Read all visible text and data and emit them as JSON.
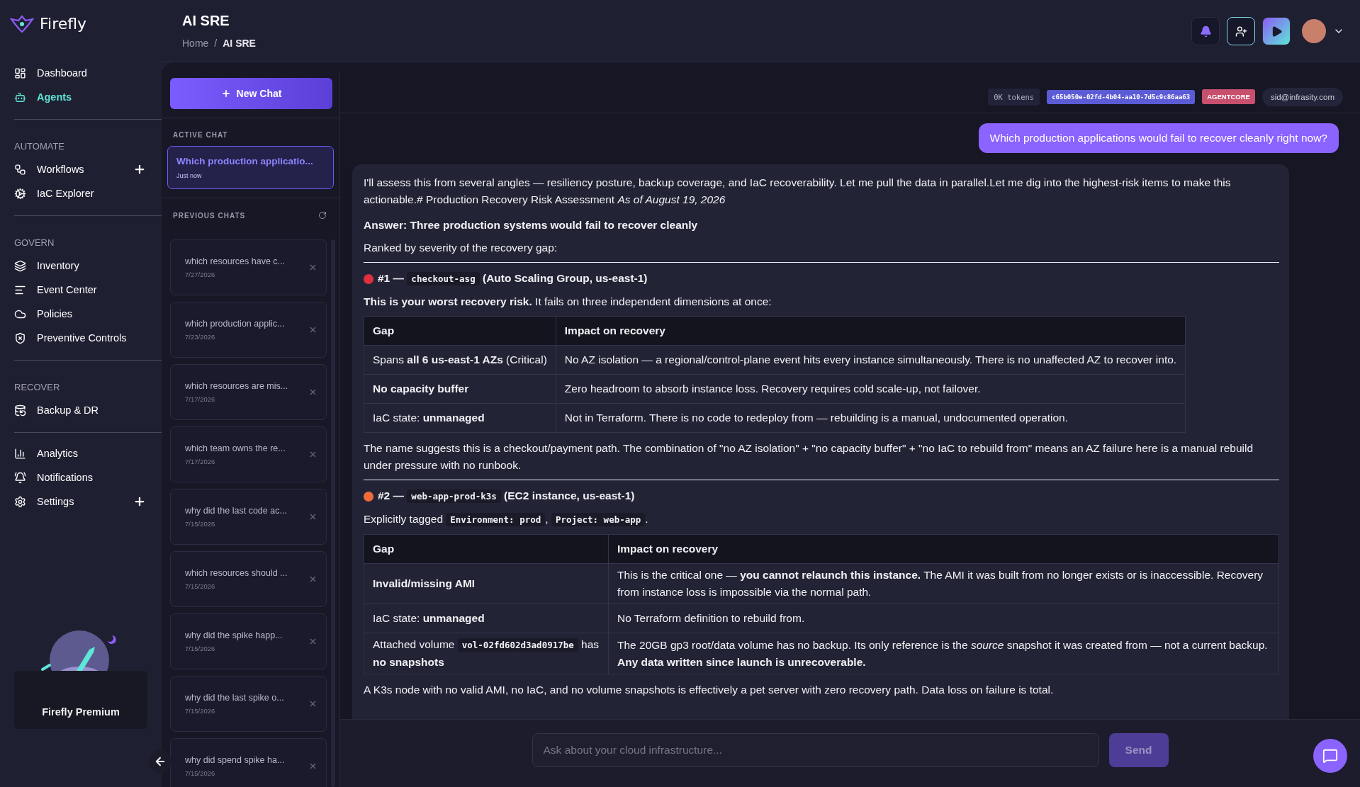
{
  "brand": {
    "name": "Firefly"
  },
  "header": {
    "title": "AI SRE",
    "breadcrumb": [
      "Home",
      "AI SRE"
    ],
    "breadcrumb_separator": "/"
  },
  "nav": [
    {
      "items": [
        {
          "label": "Dashboard",
          "selected": false,
          "has_add": false
        },
        {
          "label": "Agents",
          "selected": true,
          "has_add": false
        }
      ]
    },
    {
      "heading": "AUTOMATE",
      "items": [
        {
          "label": "Workflows",
          "selected": false,
          "has_add": true
        },
        {
          "label": "IaC Explorer",
          "selected": false,
          "has_add": false
        }
      ]
    },
    {
      "heading": "GOVERN",
      "items": [
        {
          "label": "Inventory",
          "selected": false,
          "has_add": false
        },
        {
          "label": "Event Center",
          "selected": false,
          "has_add": false
        },
        {
          "label": "Policies",
          "selected": false,
          "has_add": false
        },
        {
          "label": "Preventive Controls",
          "selected": false,
          "has_add": false
        }
      ]
    },
    {
      "heading": "RECOVER",
      "items": [
        {
          "label": "Backup & DR",
          "selected": false,
          "has_add": false
        }
      ]
    },
    {
      "items": [
        {
          "label": "Analytics",
          "selected": false,
          "has_add": false
        },
        {
          "label": "Notifications",
          "selected": false,
          "has_add": false
        },
        {
          "label": "Settings",
          "selected": false,
          "has_add": true
        }
      ]
    }
  ],
  "premium": {
    "label": "Firefly Premium"
  },
  "chats": {
    "new_chat": "New Chat",
    "active_label": "ACTIVE CHAT",
    "active": {
      "title": "Which production applicatio...",
      "time": "Just now",
      "selected": true
    },
    "previous_label": "PREVIOUS CHATS",
    "previous": [
      {
        "title": "which resources have c...",
        "date": "7/27/2026"
      },
      {
        "title": "which production applic...",
        "date": "7/23/2026"
      },
      {
        "title": "which resources are mis...",
        "date": "7/17/2026"
      },
      {
        "title": "which team owns the re...",
        "date": "7/17/2026"
      },
      {
        "title": "why did the last code ac...",
        "date": "7/15/2026"
      },
      {
        "title": "which resources should ...",
        "date": "7/15/2026"
      },
      {
        "title": "why did the spike happ...",
        "date": "7/15/2026"
      },
      {
        "title": "why did the last spike o...",
        "date": "7/15/2026"
      },
      {
        "title": "why did spend spike ha...",
        "date": "7/15/2026"
      }
    ]
  },
  "session": {
    "tokens": "0K tokens",
    "id": "c65b050e-02fd-4b04-aa10-7d5c9c86aa63",
    "badge": "AGENTCORE",
    "user": "sid@infrasity.com"
  },
  "user_message": "Which production applications would fail to recover cleanly right now?",
  "answer": {
    "intro": "I'll assess this from several angles — resiliency posture, backup coverage, and IaC recoverability. Let me pull the data in parallel.Let me dig into the highest-risk items to make this actionable.# Production Recovery Risk Assessment *As of August 19, 2026*",
    "headline": "Answer: Three production systems would fail to recover cleanly",
    "lead": "Ranked by severity of the recovery gap:",
    "sections": [
      {
        "color": "#e0303f",
        "title": [
          {
            "kind": "text",
            "text": "#1 — "
          },
          {
            "kind": "code",
            "text": "checkout-asg"
          },
          {
            "kind": "text",
            "text": " (Auto Scaling Group, us-east-1)"
          }
        ],
        "intro": [
          {
            "kind": "text",
            "text": "**This is your worst recovery risk.** It fails on three independent dimensions at once:"
          }
        ],
        "columns": [
          "Gap",
          "Impact on recovery"
        ],
        "rows": [
          [
            [
              {
                "kind": "text",
                "text": "Spans **all 6 us-east-1 AZs** (Critical)"
              }
            ],
            [
              {
                "kind": "text",
                "text": "No AZ isolation — a regional/control-plane event hits every instance simultaneously. There is no unaffected AZ to recover into."
              }
            ]
          ],
          [
            [
              {
                "kind": "text",
                "text": "**No capacity buffer**"
              }
            ],
            [
              {
                "kind": "text",
                "text": "Zero headroom to absorb instance loss. Recovery requires cold scale-up, not failover."
              }
            ]
          ],
          [
            [
              {
                "kind": "text",
                "text": "IaC state: **unmanaged**"
              }
            ],
            [
              {
                "kind": "text",
                "text": "Not in Terraform. There is no code to redeploy from — rebuilding is a manual, undocumented operation."
              }
            ]
          ]
        ],
        "summary": [
          {
            "kind": "text",
            "text": "The name suggests this is a checkout/payment path. The combination of \"no AZ isolation\" + \"no capacity buffer\" + \"no IaC to rebuild from\" means an AZ failure here is a manual rebuild under pressure with no runbook."
          }
        ]
      },
      {
        "color": "#f26b3a",
        "title": [
          {
            "kind": "text",
            "text": "#2 — "
          },
          {
            "kind": "code",
            "text": "web-app-prod-k3s"
          },
          {
            "kind": "text",
            "text": " (EC2 instance, us-east-1)"
          }
        ],
        "intro": [
          {
            "kind": "text",
            "text": "Explicitly tagged "
          },
          {
            "kind": "code",
            "text": "Environment: prod"
          },
          {
            "kind": "text",
            "text": ", "
          },
          {
            "kind": "code",
            "text": "Project: web-app"
          },
          {
            "kind": "text",
            "text": "."
          }
        ],
        "columns": [
          "Gap",
          "Impact on recovery"
        ],
        "rows": [
          [
            [
              {
                "kind": "text",
                "text": "**Invalid/missing AMI**"
              }
            ],
            [
              {
                "kind": "text",
                "text": "This is the critical one — **you cannot relaunch this instance.** The AMI it was built from no longer exists or is inaccessible. Recovery from instance loss is impossible via the normal path."
              }
            ]
          ],
          [
            [
              {
                "kind": "text",
                "text": "IaC state: **unmanaged**"
              }
            ],
            [
              {
                "kind": "text",
                "text": "No Terraform definition to rebuild from."
              }
            ]
          ],
          [
            [
              {
                "kind": "text",
                "text": "Attached volume "
              },
              {
                "kind": "code",
                "text": "vol-02fd602d3ad0917be"
              },
              {
                "kind": "text",
                "text": " has **no snapshots**"
              }
            ],
            [
              {
                "kind": "text",
                "text": "The 20GB gp3 root/data volume has no backup. Its only reference is the *source* snapshot it was created from — not a current backup. **Any data written since launch is unrecoverable.**"
              }
            ]
          ]
        ],
        "summary": [
          {
            "kind": "text",
            "text": "A K3s node with no valid AMI, no IaC, and no volume snapshots is effectively a pet server with zero recovery path. Data loss on failure is total."
          }
        ]
      }
    ]
  },
  "composer": {
    "placeholder": "Ask about your cloud infrastructure...",
    "send": "Send",
    "disabled": true
  }
}
